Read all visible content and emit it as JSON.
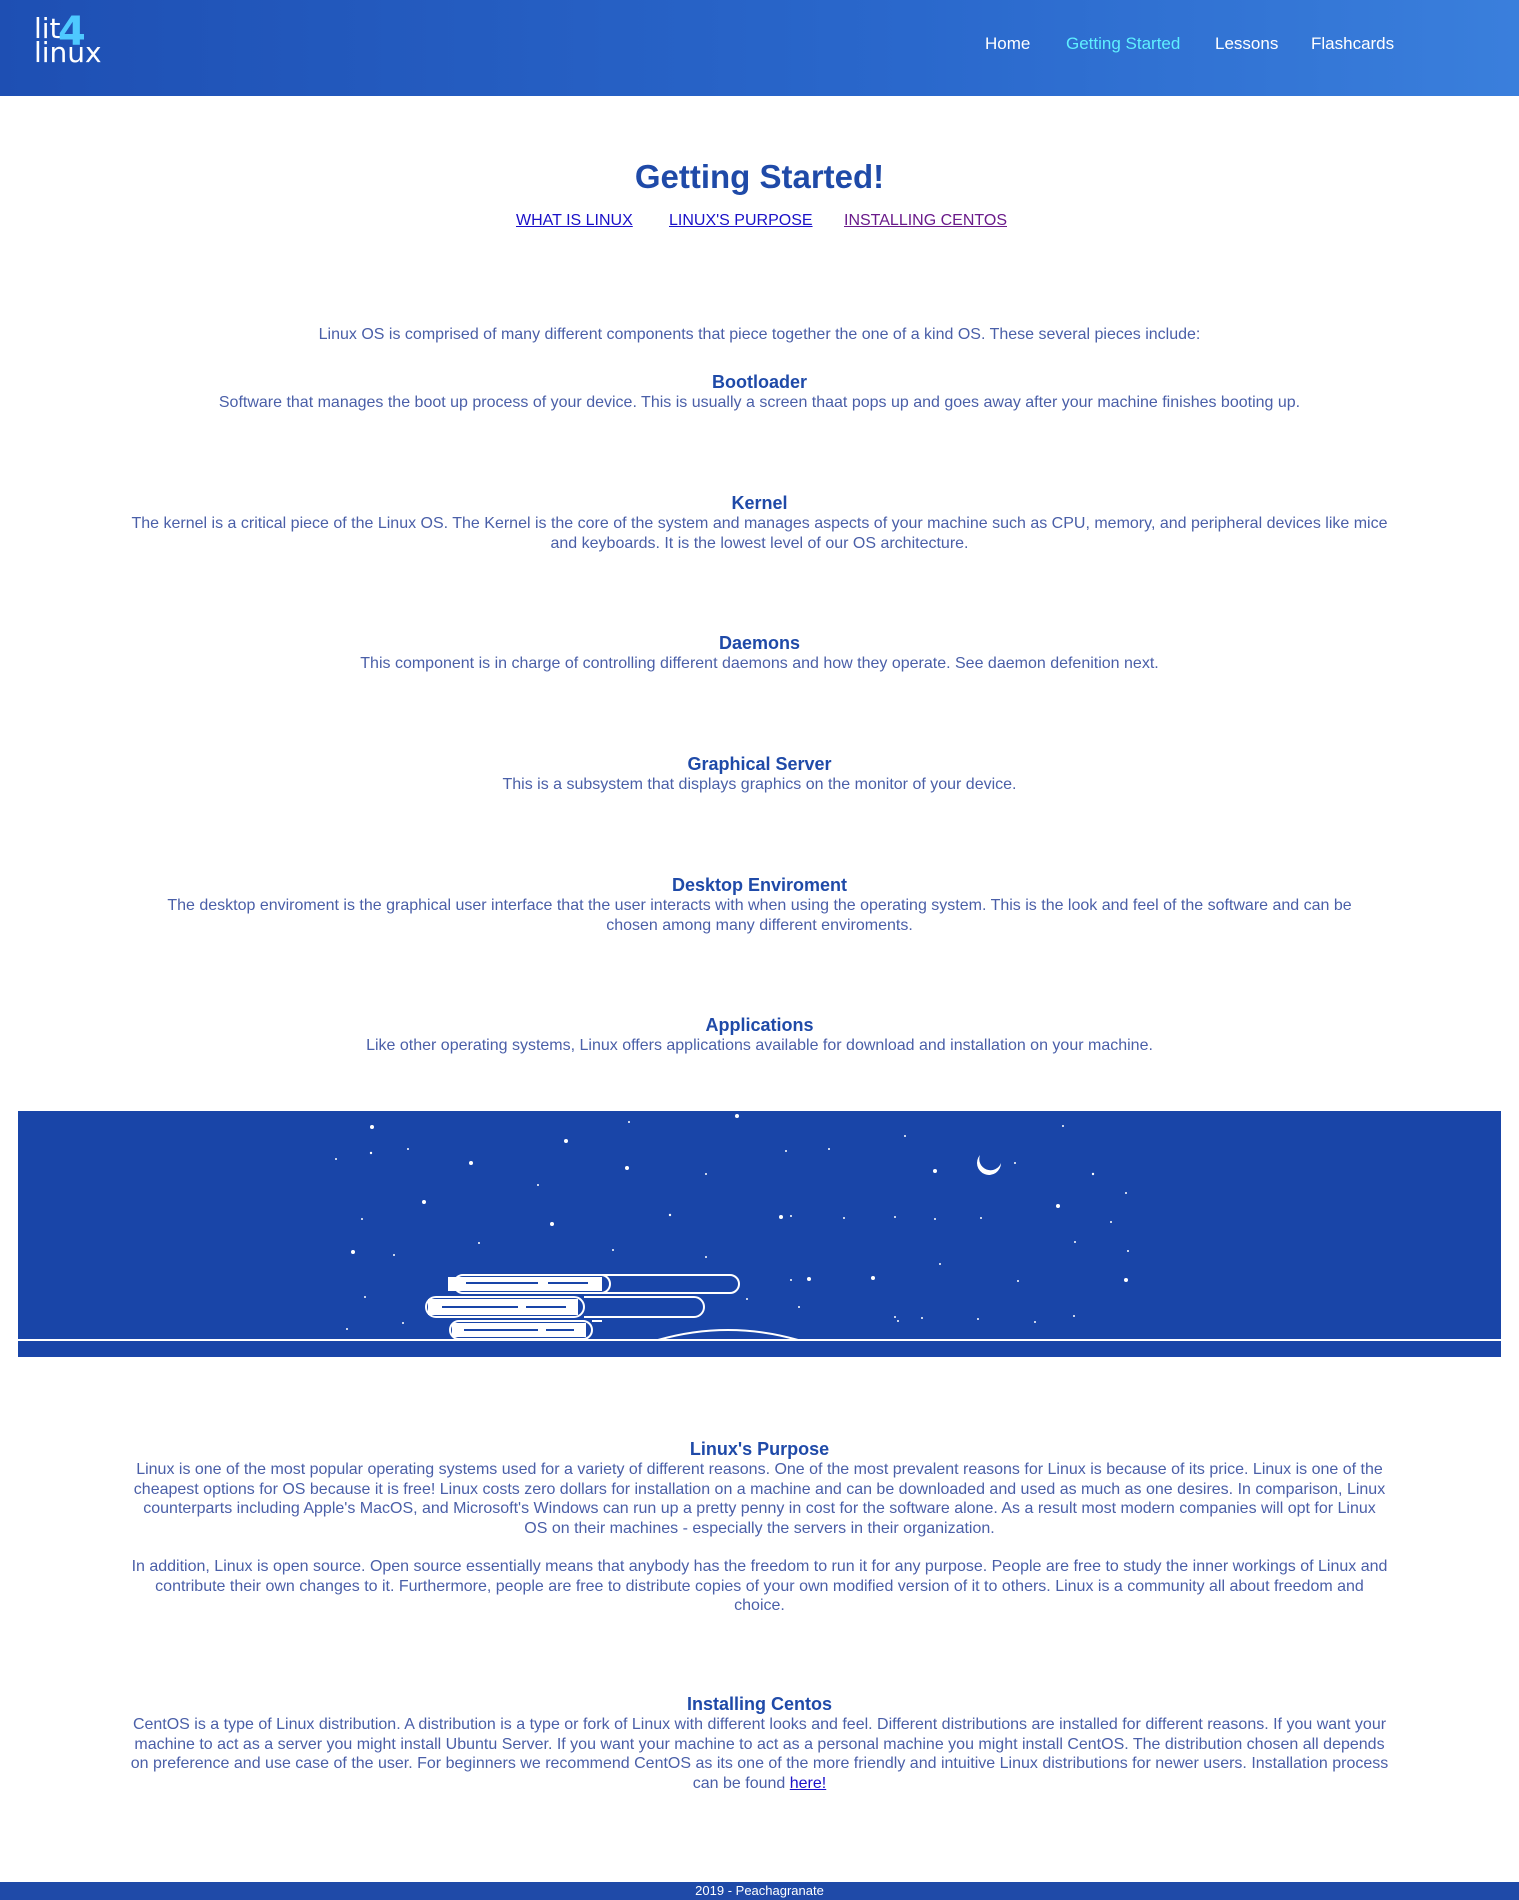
{
  "header": {
    "logo": {
      "line1": "lit",
      "digit": "4",
      "line2": "linux"
    },
    "nav": [
      {
        "label": "Home",
        "active": false
      },
      {
        "label": "Getting Started",
        "active": true
      },
      {
        "label": "Lessons",
        "active": false
      },
      {
        "label": "Flashcards",
        "active": false
      }
    ]
  },
  "main": {
    "title": "Getting Started!",
    "anchors": [
      "WHAT IS LINUX",
      "LINUX'S PURPOSE",
      "INSTALLING CENTOS"
    ],
    "intro": "Linux OS is comprised of many different components that piece together the one of a kind OS. These several pieces include:",
    "components": [
      {
        "title": "Bootloader",
        "text": "Software that manages the boot up process of your device. This is usually a screen thaat pops up and goes away after your machine finishes booting up."
      },
      {
        "title": "Kernel",
        "text": "The kernel is a critical piece of the Linux OS. The Kernel is the core of the system and manages aspects of your machine such as CPU, memory, and peripheral devices like mice and keyboards. It is the lowest level of our OS architecture."
      },
      {
        "title": "Daemons",
        "text": "This component is in charge of controlling different daemons and how they operate. See daemon defenition next."
      },
      {
        "title": "Graphical Server",
        "text": "This is a subsystem that displays graphics on the monitor of your device."
      },
      {
        "title": "Desktop Enviroment",
        "text": "The desktop enviroment is the graphical user interface that the user interacts with when using the operating system. This is the look and feel of the software and can be chosen among many different enviroments."
      },
      {
        "title": "Applications",
        "text": "Like other operating systems, Linux offers applications available for download and installation on your machine."
      }
    ],
    "purpose": {
      "title": "Linux's Purpose",
      "p1": "Linux is one of the most popular operating systems used for a variety of different reasons. One of the most prevalent reasons for Linux is because of its price. Linux is one of the cheapest options for OS because it is free! Linux costs zero dollars for installation on a machine and can be downloaded and used as much as one desires. In comparison, Linux counterparts including Apple's MacOS, and Microsoft's Windows can run up a pretty penny in cost for the software alone. As a result most modern companies will opt for Linux OS on their machines - especially the servers in their organization.",
      "p2": "In addition, Linux is open source. Open source essentially means that anybody has the freedom to run it for any purpose. People are free to study the inner workings of Linux and contribute their own changes to it. Furthermore, people are free to distribute copies of your own modified version of it to others. Linux is a community all about freedom and choice."
    },
    "centos": {
      "title": "Installing Centos",
      "text": "CentOS is a type of Linux distribution. A distribution is a type or fork of Linux with different looks and feel. Different distributions are installed for different reasons. If you want your machine to act as a server you might install Ubuntu Server. If you want your machine to act as a personal machine you might install CentOS. The distribution chosen all depends on preference and use case of the user. For beginners we recommend CentOS as its one of the more friendly and intuitive Linux distributions for newer users. Installation process can be found ",
      "link": "here!"
    }
  },
  "banner": {
    "background": "#1945a8",
    "icons": [
      "moon-icon",
      "books-icon",
      "stars"
    ]
  },
  "footer": {
    "text": "2019 - Peachagranate"
  },
  "colors": {
    "header_start": "#1e4fb3",
    "header_end": "#3a7fdc",
    "heading": "#1f4aa8",
    "body_text": "#4a5fa8",
    "nav_active": "#5ff0ff"
  }
}
